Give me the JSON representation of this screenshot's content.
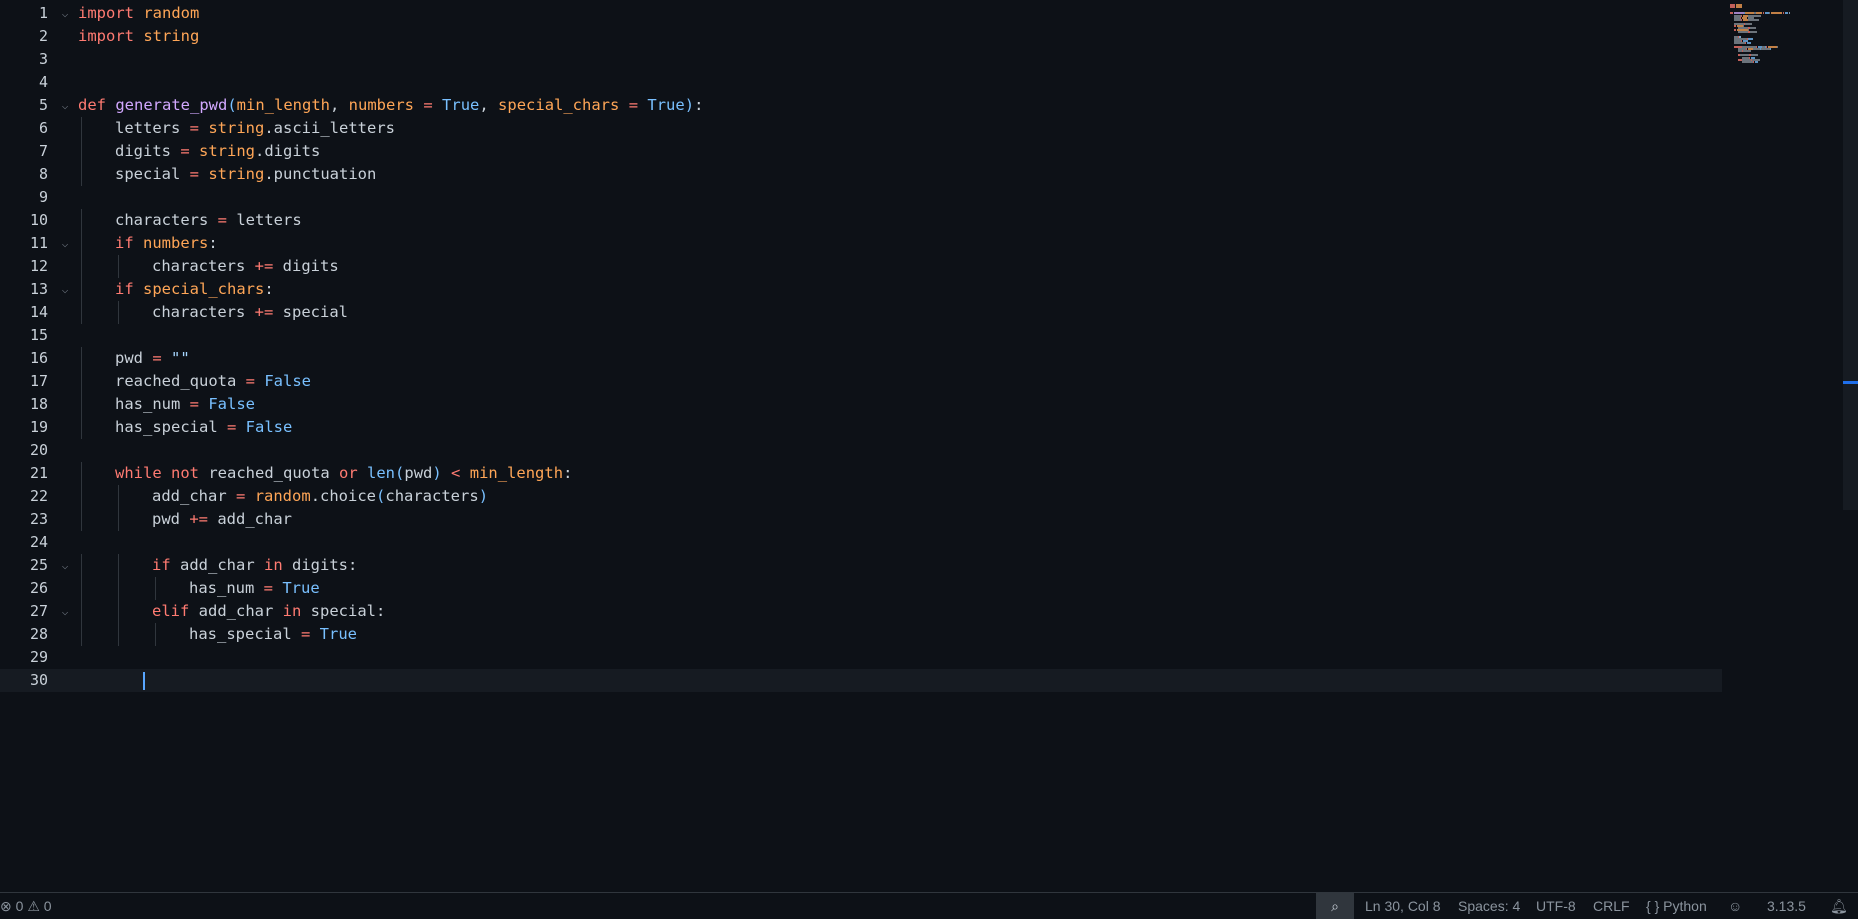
{
  "editor": {
    "lines": [
      {
        "n": "1",
        "fold": true,
        "indent": 0,
        "tokens": [
          [
            "kw",
            "import"
          ],
          [
            "id",
            " "
          ],
          [
            "mod",
            "random"
          ]
        ]
      },
      {
        "n": "2",
        "fold": false,
        "indent": 0,
        "tokens": [
          [
            "kw",
            "import"
          ],
          [
            "id",
            " "
          ],
          [
            "mod",
            "string"
          ]
        ]
      },
      {
        "n": "3",
        "fold": false,
        "indent": 0,
        "tokens": []
      },
      {
        "n": "4",
        "fold": false,
        "indent": 0,
        "tokens": []
      },
      {
        "n": "5",
        "fold": true,
        "indent": 0,
        "tokens": [
          [
            "kw",
            "def"
          ],
          [
            "id",
            " "
          ],
          [
            "fn",
            "generate_pwd"
          ],
          [
            "const",
            "("
          ],
          [
            "param",
            "min_length"
          ],
          [
            "id",
            ", "
          ],
          [
            "param",
            "numbers"
          ],
          [
            "id",
            " "
          ],
          [
            "op",
            "="
          ],
          [
            "id",
            " "
          ],
          [
            "const",
            "True"
          ],
          [
            "id",
            ", "
          ],
          [
            "param",
            "special_chars"
          ],
          [
            "id",
            " "
          ],
          [
            "op",
            "="
          ],
          [
            "id",
            " "
          ],
          [
            "const",
            "True"
          ],
          [
            "const",
            ")"
          ],
          [
            "id",
            ":"
          ]
        ]
      },
      {
        "n": "6",
        "fold": false,
        "indent": 1,
        "tokens": [
          [
            "id",
            "letters "
          ],
          [
            "op",
            "="
          ],
          [
            "id",
            " "
          ],
          [
            "mod",
            "string"
          ],
          [
            "id",
            ".ascii_letters"
          ]
        ]
      },
      {
        "n": "7",
        "fold": false,
        "indent": 1,
        "tokens": [
          [
            "id",
            "digits "
          ],
          [
            "op",
            "="
          ],
          [
            "id",
            " "
          ],
          [
            "mod",
            "string"
          ],
          [
            "id",
            ".digits"
          ]
        ]
      },
      {
        "n": "8",
        "fold": false,
        "indent": 1,
        "tokens": [
          [
            "id",
            "special "
          ],
          [
            "op",
            "="
          ],
          [
            "id",
            " "
          ],
          [
            "mod",
            "string"
          ],
          [
            "id",
            ".punctuation"
          ]
        ]
      },
      {
        "n": "9",
        "fold": false,
        "indent": 0,
        "tokens": []
      },
      {
        "n": "10",
        "fold": false,
        "indent": 1,
        "tokens": [
          [
            "id",
            "characters "
          ],
          [
            "op",
            "="
          ],
          [
            "id",
            " letters"
          ]
        ]
      },
      {
        "n": "11",
        "fold": true,
        "indent": 1,
        "tokens": [
          [
            "kw",
            "if"
          ],
          [
            "id",
            " "
          ],
          [
            "param",
            "numbers"
          ],
          [
            "id",
            ":"
          ]
        ]
      },
      {
        "n": "12",
        "fold": false,
        "indent": 2,
        "tokens": [
          [
            "id",
            "characters "
          ],
          [
            "op",
            "+="
          ],
          [
            "id",
            " digits"
          ]
        ]
      },
      {
        "n": "13",
        "fold": true,
        "indent": 1,
        "tokens": [
          [
            "kw",
            "if"
          ],
          [
            "id",
            " "
          ],
          [
            "param",
            "special_chars"
          ],
          [
            "id",
            ":"
          ]
        ]
      },
      {
        "n": "14",
        "fold": false,
        "indent": 2,
        "tokens": [
          [
            "id",
            "characters "
          ],
          [
            "op",
            "+="
          ],
          [
            "id",
            " special"
          ]
        ]
      },
      {
        "n": "15",
        "fold": false,
        "indent": 0,
        "tokens": []
      },
      {
        "n": "16",
        "fold": false,
        "indent": 1,
        "tokens": [
          [
            "id",
            "pwd "
          ],
          [
            "op",
            "="
          ],
          [
            "id",
            " "
          ],
          [
            "str",
            "\"\""
          ]
        ]
      },
      {
        "n": "17",
        "fold": false,
        "indent": 1,
        "tokens": [
          [
            "id",
            "reached_quota "
          ],
          [
            "op",
            "="
          ],
          [
            "id",
            " "
          ],
          [
            "const",
            "False"
          ]
        ]
      },
      {
        "n": "18",
        "fold": false,
        "indent": 1,
        "tokens": [
          [
            "id",
            "has_num "
          ],
          [
            "op",
            "="
          ],
          [
            "id",
            " "
          ],
          [
            "const",
            "False"
          ]
        ]
      },
      {
        "n": "19",
        "fold": false,
        "indent": 1,
        "tokens": [
          [
            "id",
            "has_special "
          ],
          [
            "op",
            "="
          ],
          [
            "id",
            " "
          ],
          [
            "const",
            "False"
          ]
        ]
      },
      {
        "n": "20",
        "fold": false,
        "indent": 0,
        "tokens": []
      },
      {
        "n": "21",
        "fold": false,
        "indent": 1,
        "tokens": [
          [
            "kw",
            "while"
          ],
          [
            "id",
            " "
          ],
          [
            "kw",
            "not"
          ],
          [
            "id",
            " reached_quota "
          ],
          [
            "kw",
            "or"
          ],
          [
            "id",
            " "
          ],
          [
            "const",
            "len"
          ],
          [
            "const",
            "("
          ],
          [
            "id",
            "pwd"
          ],
          [
            "const",
            ")"
          ],
          [
            "id",
            " "
          ],
          [
            "op",
            "<"
          ],
          [
            "id",
            " "
          ],
          [
            "param",
            "min_length"
          ],
          [
            "id",
            ":"
          ]
        ]
      },
      {
        "n": "22",
        "fold": false,
        "indent": 2,
        "tokens": [
          [
            "id",
            "add_char "
          ],
          [
            "op",
            "="
          ],
          [
            "id",
            " "
          ],
          [
            "mod",
            "random"
          ],
          [
            "id",
            ".choice"
          ],
          [
            "const",
            "("
          ],
          [
            "id",
            "characters"
          ],
          [
            "const",
            ")"
          ]
        ]
      },
      {
        "n": "23",
        "fold": false,
        "indent": 2,
        "tokens": [
          [
            "id",
            "pwd "
          ],
          [
            "op",
            "+="
          ],
          [
            "id",
            " add_char"
          ]
        ]
      },
      {
        "n": "24",
        "fold": false,
        "indent": 0,
        "tokens": []
      },
      {
        "n": "25",
        "fold": true,
        "indent": 2,
        "tokens": [
          [
            "kw",
            "if"
          ],
          [
            "id",
            " add_char "
          ],
          [
            "kw",
            "in"
          ],
          [
            "id",
            " digits:"
          ]
        ]
      },
      {
        "n": "26",
        "fold": false,
        "indent": 3,
        "tokens": [
          [
            "id",
            "has_num "
          ],
          [
            "op",
            "="
          ],
          [
            "id",
            " "
          ],
          [
            "const",
            "True"
          ]
        ]
      },
      {
        "n": "27",
        "fold": true,
        "indent": 2,
        "tokens": [
          [
            "kw",
            "elif"
          ],
          [
            "id",
            " add_char "
          ],
          [
            "kw",
            "in"
          ],
          [
            "id",
            " special:"
          ]
        ]
      },
      {
        "n": "28",
        "fold": false,
        "indent": 3,
        "tokens": [
          [
            "id",
            "has_special "
          ],
          [
            "op",
            "="
          ],
          [
            "id",
            " "
          ],
          [
            "const",
            "True"
          ]
        ]
      },
      {
        "n": "29",
        "fold": false,
        "indent": 0,
        "tokens": []
      },
      {
        "n": "30",
        "fold": false,
        "indent": 0,
        "tokens": [],
        "current": true
      }
    ]
  },
  "statusbar": {
    "errors": "0",
    "warnings": "0",
    "position": "Ln 30, Col 8",
    "spaces": "Spaces: 4",
    "encoding": "UTF-8",
    "eol": "CRLF",
    "language_icon": "{ }",
    "language": "Python",
    "python_version": "3.13.5"
  },
  "colors": {
    "background": "#0d1117",
    "keyword": "#ff7b72",
    "function": "#d2a8ff",
    "param": "#ffa657",
    "constant": "#79c0ff",
    "text": "#c9d1d9",
    "accent": "#1f6feb"
  }
}
